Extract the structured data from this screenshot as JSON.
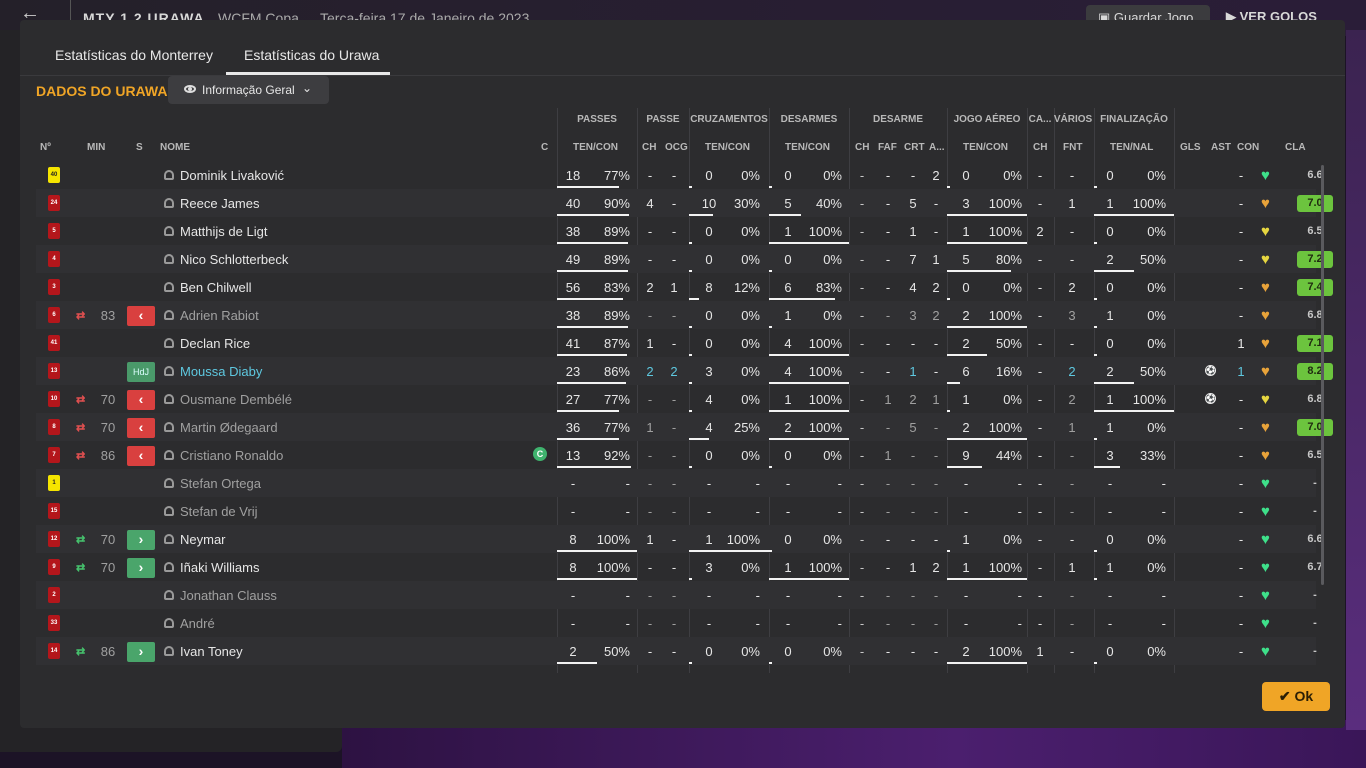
{
  "top": {
    "score": "MTY 1 2 URAWA",
    "competition": "WCFM Copa",
    "date": "Terça-feira 17 de Janeiro de 2023",
    "save": "Guardar Jogo",
    "goals": "VER GOLOS"
  },
  "tabs": {
    "tab1": "Estatísticas do Monterrey",
    "tab2": "Estatísticas do Urawa"
  },
  "title": "DADOS DO URAWA",
  "dropdown": "Informação Geral",
  "groups": {
    "passes": "PASSES",
    "passe": "PASSE",
    "cruz": "CRUZAMENTOS",
    "desarmes": "DESARMES",
    "desarme": "DESARME",
    "aereo": "JOGO AÉREO",
    "ca": "CA...",
    "varios": "VÁRIOS",
    "final": "FINALIZAÇÃO"
  },
  "headers": {
    "no": "Nº",
    "min": "MIN",
    "s": "S",
    "nome": "NOME",
    "c": "C",
    "ten_con": "TEN/CON",
    "ch": "CH",
    "ocg": "OCG",
    "faf": "FAF",
    "crt": "CRT",
    "a": "A...",
    "fnt": "FNT",
    "ten_nal": "TEN/NAL",
    "gls": "GLS",
    "ast": "AST",
    "con": "CON",
    "cla": "CLA"
  },
  "players": [
    {
      "no": "40",
      "kit": "yel",
      "min": "",
      "arrow": "",
      "sub": "",
      "name": "Dominik Livaković",
      "dim": false,
      "cap": false,
      "pt": "18",
      "pp": "77%",
      "pf": 0.77,
      "ch": "-",
      "ocg": "-",
      "cz": "0",
      "czp": "0%",
      "czf": 0,
      "ds": "0",
      "dsp": "0%",
      "dsf": 0,
      "dch": "-",
      "faf": "-",
      "crt": "-",
      "da": "2",
      "ae": "0",
      "aep": "0%",
      "aef": 0,
      "ca": "-",
      "fnt": "-",
      "ft": "0",
      "fp": "0%",
      "ff": 0,
      "gls": "",
      "ast": "-",
      "con": "green",
      "cla": "6.6",
      "claGreen": false
    },
    {
      "no": "24",
      "kit": "red",
      "min": "",
      "arrow": "",
      "sub": "",
      "name": "Reece James",
      "dim": false,
      "cap": false,
      "pt": "40",
      "pp": "90%",
      "pf": 0.9,
      "ch": "4",
      "ocg": "-",
      "cz": "10",
      "czp": "30%",
      "czf": 0.3,
      "ds": "5",
      "dsp": "40%",
      "dsf": 0.4,
      "dch": "-",
      "faf": "-",
      "crt": "5",
      "da": "-",
      "ae": "3",
      "aep": "100%",
      "aef": 1,
      "ca": "-",
      "fnt": "1",
      "ft": "1",
      "fp": "100%",
      "ff": 1,
      "gls": "",
      "ast": "-",
      "con": "orange",
      "cla": "7.0",
      "claGreen": true
    },
    {
      "no": "5",
      "kit": "red",
      "min": "",
      "arrow": "",
      "sub": "",
      "name": "Matthijs de Ligt",
      "dim": false,
      "cap": false,
      "pt": "38",
      "pp": "89%",
      "pf": 0.89,
      "ch": "-",
      "ocg": "-",
      "cz": "0",
      "czp": "0%",
      "czf": 0,
      "ds": "1",
      "dsp": "100%",
      "dsf": 1,
      "dch": "-",
      "faf": "-",
      "crt": "1",
      "da": "-",
      "ae": "1",
      "aep": "100%",
      "aef": 1,
      "ca": "2",
      "fnt": "-",
      "ft": "0",
      "fp": "0%",
      "ff": 0,
      "gls": "",
      "ast": "-",
      "con": "yellow",
      "cla": "6.5",
      "claGreen": false
    },
    {
      "no": "4",
      "kit": "red",
      "min": "",
      "arrow": "",
      "sub": "",
      "name": "Nico Schlotterbeck",
      "dim": false,
      "cap": false,
      "pt": "49",
      "pp": "89%",
      "pf": 0.89,
      "ch": "-",
      "ocg": "-",
      "cz": "0",
      "czp": "0%",
      "czf": 0,
      "ds": "0",
      "dsp": "0%",
      "dsf": 0,
      "dch": "-",
      "faf": "-",
      "crt": "7",
      "da": "1",
      "ae": "5",
      "aep": "80%",
      "aef": 0.8,
      "ca": "-",
      "fnt": "-",
      "ft": "2",
      "fp": "50%",
      "ff": 0.5,
      "gls": "",
      "ast": "-",
      "con": "yellow",
      "cla": "7.2",
      "claGreen": true
    },
    {
      "no": "3",
      "kit": "red",
      "min": "",
      "arrow": "",
      "sub": "",
      "name": "Ben Chilwell",
      "dim": false,
      "cap": false,
      "pt": "56",
      "pp": "83%",
      "pf": 0.83,
      "ch": "2",
      "ocg": "1",
      "cz": "8",
      "czp": "12%",
      "czf": 0.12,
      "ds": "6",
      "dsp": "83%",
      "dsf": 0.83,
      "dch": "-",
      "faf": "-",
      "crt": "4",
      "da": "2",
      "ae": "0",
      "aep": "0%",
      "aef": 0,
      "ca": "-",
      "fnt": "2",
      "ft": "0",
      "fp": "0%",
      "ff": 0,
      "gls": "",
      "ast": "-",
      "con": "orange",
      "cla": "7.4",
      "claGreen": true
    },
    {
      "no": "6",
      "kit": "red",
      "min": "83",
      "arrow": "red",
      "sub": "red",
      "name": "Adrien Rabiot",
      "dim": true,
      "cap": false,
      "pt": "38",
      "pp": "89%",
      "pf": 0.89,
      "ch": "-",
      "ocg": "-",
      "cz": "0",
      "czp": "0%",
      "czf": 0,
      "ds": "1",
      "dsp": "0%",
      "dsf": 0,
      "dch": "-",
      "faf": "-",
      "crt": "3",
      "da": "2",
      "ae": "2",
      "aep": "100%",
      "aef": 1,
      "ca": "-",
      "fnt": "3",
      "ft": "1",
      "fp": "0%",
      "ff": 0,
      "gls": "",
      "ast": "-",
      "con": "orange",
      "cla": "6.8",
      "claGreen": false
    },
    {
      "no": "41",
      "kit": "red",
      "min": "",
      "arrow": "",
      "sub": "",
      "name": "Declan Rice",
      "dim": false,
      "cap": false,
      "pt": "41",
      "pp": "87%",
      "pf": 0.87,
      "ch": "1",
      "ocg": "-",
      "cz": "0",
      "czp": "0%",
      "czf": 0,
      "ds": "4",
      "dsp": "100%",
      "dsf": 1,
      "dch": "-",
      "faf": "-",
      "crt": "-",
      "da": "-",
      "ae": "2",
      "aep": "50%",
      "aef": 0.5,
      "ca": "-",
      "fnt": "-",
      "ft": "0",
      "fp": "0%",
      "ff": 0,
      "gls": "",
      "ast": "1",
      "con": "orange",
      "cla": "7.1",
      "claGreen": true
    },
    {
      "no": "13",
      "kit": "red",
      "min": "",
      "arrow": "",
      "sub": "hdj",
      "name": "Moussa Diaby",
      "dim": false,
      "cyan": true,
      "cap": false,
      "pt": "23",
      "pp": "86%",
      "pf": 0.86,
      "ch": "2",
      "ocg": "2",
      "cz": "3",
      "czp": "0%",
      "czf": 0,
      "ds": "4",
      "dsp": "100%",
      "dsf": 1,
      "dch": "-",
      "faf": "-",
      "crt": "1",
      "da": "-",
      "ae": "6",
      "aep": "16%",
      "aef": 0.16,
      "ca": "-",
      "fnt": "2",
      "ft": "2",
      "fp": "50%",
      "ff": 0.5,
      "gls": "ball",
      "ast": "1",
      "con": "orange",
      "cla": "8.2",
      "claGreen": true
    },
    {
      "no": "10",
      "kit": "red",
      "min": "70",
      "arrow": "red",
      "sub": "red",
      "name": "Ousmane Dembélé",
      "dim": true,
      "cap": false,
      "pt": "27",
      "pp": "77%",
      "pf": 0.77,
      "ch": "-",
      "ocg": "-",
      "cz": "4",
      "czp": "0%",
      "czf": 0,
      "ds": "1",
      "dsp": "100%",
      "dsf": 1,
      "dch": "-",
      "faf": "1",
      "crt": "2",
      "da": "1",
      "ae": "1",
      "aep": "0%",
      "aef": 0,
      "ca": "-",
      "fnt": "2",
      "ft": "1",
      "fp": "100%",
      "ff": 1,
      "gls": "ball",
      "ast": "-",
      "con": "yellow",
      "cla": "6.8",
      "claGreen": false
    },
    {
      "no": "8",
      "kit": "red",
      "min": "70",
      "arrow": "red",
      "sub": "red",
      "name": "Martin Ødegaard",
      "dim": true,
      "cap": false,
      "pt": "36",
      "pp": "77%",
      "pf": 0.77,
      "ch": "1",
      "ocg": "-",
      "cz": "4",
      "czp": "25%",
      "czf": 0.25,
      "ds": "2",
      "dsp": "100%",
      "dsf": 1,
      "dch": "-",
      "faf": "-",
      "crt": "5",
      "da": "-",
      "ae": "2",
      "aep": "100%",
      "aef": 1,
      "ca": "-",
      "fnt": "1",
      "ft": "1",
      "fp": "0%",
      "ff": 0,
      "gls": "",
      "ast": "-",
      "con": "orange",
      "cla": "7.0",
      "claGreen": true
    },
    {
      "no": "7",
      "kit": "red",
      "min": "86",
      "arrow": "red",
      "sub": "red",
      "name": "Cristiano Ronaldo",
      "dim": true,
      "cap": true,
      "pt": "13",
      "pp": "92%",
      "pf": 0.92,
      "ch": "-",
      "ocg": "-",
      "cz": "0",
      "czp": "0%",
      "czf": 0,
      "ds": "0",
      "dsp": "0%",
      "dsf": 0,
      "dch": "-",
      "faf": "1",
      "crt": "-",
      "da": "-",
      "ae": "9",
      "aep": "44%",
      "aef": 0.44,
      "ca": "-",
      "fnt": "-",
      "ft": "3",
      "fp": "33%",
      "ff": 0.33,
      "gls": "",
      "ast": "-",
      "con": "orange",
      "cla": "6.5",
      "claGreen": false
    },
    {
      "no": "1",
      "kit": "yel",
      "min": "",
      "arrow": "",
      "sub": "",
      "name": "Stefan Ortega",
      "dim": true,
      "cap": false,
      "pt": "-",
      "pp": "-",
      "pf": -1,
      "ch": "-",
      "ocg": "-",
      "cz": "-",
      "czp": "-",
      "czf": -1,
      "ds": "-",
      "dsp": "-",
      "dsf": -1,
      "dch": "-",
      "faf": "-",
      "crt": "-",
      "da": "-",
      "ae": "-",
      "aep": "-",
      "aef": -1,
      "ca": "-",
      "fnt": "-",
      "ft": "-",
      "fp": "-",
      "ff": -1,
      "gls": "",
      "ast": "-",
      "con": "green",
      "cla": "-",
      "claGreen": false
    },
    {
      "no": "15",
      "kit": "red",
      "min": "",
      "arrow": "",
      "sub": "",
      "name": "Stefan de Vrij",
      "dim": true,
      "cap": false,
      "pt": "-",
      "pp": "-",
      "pf": -1,
      "ch": "-",
      "ocg": "-",
      "cz": "-",
      "czp": "-",
      "czf": -1,
      "ds": "-",
      "dsp": "-",
      "dsf": -1,
      "dch": "-",
      "faf": "-",
      "crt": "-",
      "da": "-",
      "ae": "-",
      "aep": "-",
      "aef": -1,
      "ca": "-",
      "fnt": "-",
      "ft": "-",
      "fp": "-",
      "ff": -1,
      "gls": "",
      "ast": "-",
      "con": "green",
      "cla": "-",
      "claGreen": false
    },
    {
      "no": "12",
      "kit": "red",
      "min": "70",
      "arrow": "green",
      "sub": "green",
      "name": "Neymar",
      "dim": false,
      "cap": false,
      "pt": "8",
      "pp": "100%",
      "pf": 1,
      "ch": "1",
      "ocg": "-",
      "cz": "1",
      "czp": "100%",
      "czf": 1,
      "ds": "0",
      "dsp": "0%",
      "dsf": 0,
      "dch": "-",
      "faf": "-",
      "crt": "-",
      "da": "-",
      "ae": "1",
      "aep": "0%",
      "aef": 0,
      "ca": "-",
      "fnt": "-",
      "ft": "0",
      "fp": "0%",
      "ff": 0,
      "gls": "",
      "ast": "-",
      "con": "green",
      "cla": "6.6",
      "claGreen": false
    },
    {
      "no": "9",
      "kit": "red",
      "min": "70",
      "arrow": "green",
      "sub": "green",
      "name": "Iñaki Williams",
      "dim": false,
      "cap": false,
      "pt": "8",
      "pp": "100%",
      "pf": 1,
      "ch": "-",
      "ocg": "-",
      "cz": "3",
      "czp": "0%",
      "czf": 0,
      "ds": "1",
      "dsp": "100%",
      "dsf": 1,
      "dch": "-",
      "faf": "-",
      "crt": "1",
      "da": "2",
      "ae": "1",
      "aep": "100%",
      "aef": 1,
      "ca": "-",
      "fnt": "1",
      "ft": "1",
      "fp": "0%",
      "ff": 0,
      "gls": "",
      "ast": "-",
      "con": "green",
      "cla": "6.7",
      "claGreen": false
    },
    {
      "no": "2",
      "kit": "red",
      "min": "",
      "arrow": "",
      "sub": "",
      "name": "Jonathan Clauss",
      "dim": true,
      "cap": false,
      "pt": "-",
      "pp": "-",
      "pf": -1,
      "ch": "-",
      "ocg": "-",
      "cz": "-",
      "czp": "-",
      "czf": -1,
      "ds": "-",
      "dsp": "-",
      "dsf": -1,
      "dch": "-",
      "faf": "-",
      "crt": "-",
      "da": "-",
      "ae": "-",
      "aep": "-",
      "aef": -1,
      "ca": "-",
      "fnt": "-",
      "ft": "-",
      "fp": "-",
      "ff": -1,
      "gls": "",
      "ast": "-",
      "con": "green",
      "cla": "-",
      "claGreen": false
    },
    {
      "no": "33",
      "kit": "red",
      "min": "",
      "arrow": "",
      "sub": "",
      "name": "André",
      "dim": true,
      "cap": false,
      "pt": "-",
      "pp": "-",
      "pf": -1,
      "ch": "-",
      "ocg": "-",
      "cz": "-",
      "czp": "-",
      "czf": -1,
      "ds": "-",
      "dsp": "-",
      "dsf": -1,
      "dch": "-",
      "faf": "-",
      "crt": "-",
      "da": "-",
      "ae": "-",
      "aep": "-",
      "aef": -1,
      "ca": "-",
      "fnt": "-",
      "ft": "-",
      "fp": "-",
      "ff": -1,
      "gls": "",
      "ast": "-",
      "con": "green",
      "cla": "-",
      "claGreen": false
    },
    {
      "no": "14",
      "kit": "red",
      "min": "86",
      "arrow": "green",
      "sub": "green",
      "name": "Ivan Toney",
      "dim": false,
      "cap": false,
      "pt": "2",
      "pp": "50%",
      "pf": 0.5,
      "ch": "-",
      "ocg": "-",
      "cz": "0",
      "czp": "0%",
      "czf": 0,
      "ds": "0",
      "dsp": "0%",
      "dsf": 0,
      "dch": "-",
      "faf": "-",
      "crt": "-",
      "da": "-",
      "ae": "2",
      "aep": "100%",
      "aef": 1,
      "ca": "1",
      "fnt": "-",
      "ft": "0",
      "fp": "0%",
      "ff": 0,
      "gls": "",
      "ast": "-",
      "con": "green",
      "cla": "-",
      "claGreen": false
    }
  ],
  "ok": "Ok",
  "colors": {
    "accent": "#f0a526",
    "ratingGreen": "#6cc43e",
    "subRed": "#d9403f",
    "subGreen": "#4aa56b",
    "heartGreen": "#3ee08a"
  }
}
